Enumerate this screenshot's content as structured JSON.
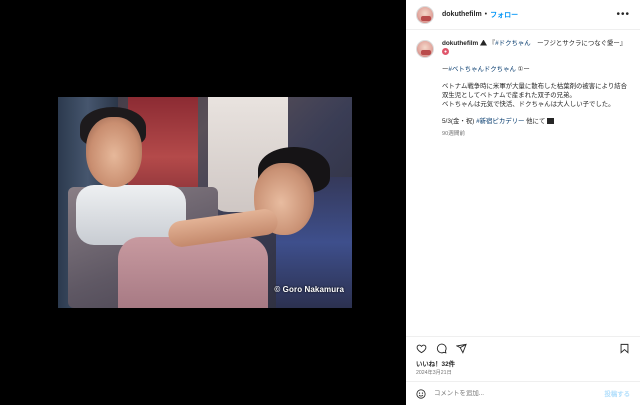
{
  "media": {
    "copyright": "© Goro Nakamura"
  },
  "header": {
    "username": "dokuthefilm",
    "separator": "•",
    "follow_label": "フォロー",
    "more_label": "•••"
  },
  "caption": {
    "username": "dokuthefilm",
    "title_part1": "『",
    "title_hashtag": "#ドクちゃん",
    "title_part2": "　ーフジとサクラにつなぐ愛ー』",
    "subtitle_prefix": "ー",
    "subtitle_hashtag": "#ベトちゃんドクちゃん",
    "subtitle_suffix": " ①ー",
    "body_line1": "ベトナム戦争時に米軍が大量に散布した枯葉剤の被害により結合双生児としてベトナムで産まれた双子の兄弟。",
    "body_line2": "ベトちゃんは元気で快活、ドクちゃんは大人しい子でした。",
    "screening_prefix": "5/3(金・祝) ",
    "screening_hashtag": "#新宿ピカデリー",
    "screening_suffix": " 他にて",
    "time_ago": "90週間前"
  },
  "actions": {
    "like_icon": "heart-icon",
    "comment_icon": "comment-bubble-icon",
    "share_icon": "paper-plane-icon",
    "save_icon": "bookmark-icon"
  },
  "likes": {
    "label": "いいね！32件"
  },
  "date": {
    "text": "2024年3月21日"
  },
  "comment_box": {
    "placeholder": "コメントを追加...",
    "post_label": "投稿する"
  },
  "colors": {
    "link_blue": "#0095f6",
    "hashtag": "#00376b",
    "post_disabled": "#b2dffc"
  }
}
